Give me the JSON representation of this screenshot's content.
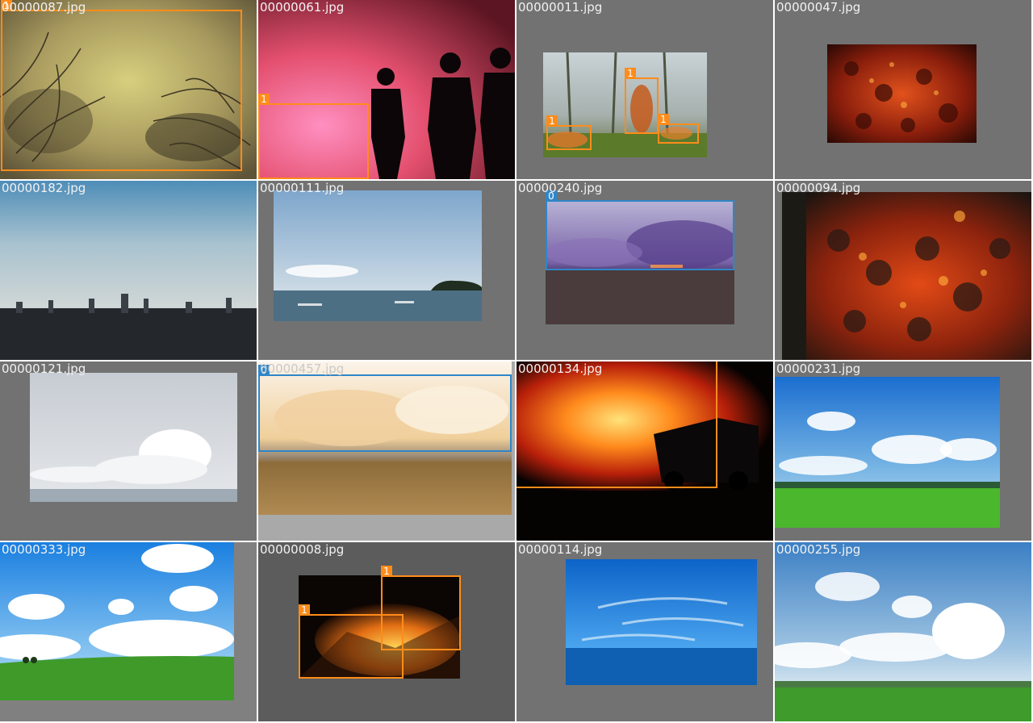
{
  "colors": {
    "gap": "#ffffff",
    "letterbox": "#727272",
    "letterbox_dark": "#5c5c5c",
    "class_1_box": "#ff8c1a",
    "class_0_box": "#2f86c8",
    "filename_text": "#f2f2f2"
  },
  "tiles": [
    {
      "filename": "00000087.jpg",
      "scene": "smoky-brush-fire",
      "boxes": [
        {
          "label": "1"
        }
      ]
    },
    {
      "filename": "00000061.jpg",
      "scene": "firefighters-silhouette-red-smoke",
      "boxes": [
        {
          "label": "1"
        }
      ]
    },
    {
      "filename": "00000011.jpg",
      "scene": "forest-floor-fire",
      "boxes": [
        {
          "label": "1"
        },
        {
          "label": "1"
        },
        {
          "label": "1"
        }
      ]
    },
    {
      "filename": "00000047.jpg",
      "scene": "glowing-embers",
      "boxes": []
    },
    {
      "filename": "00000182.jpg",
      "scene": "city-skyline-haze",
      "boxes": []
    },
    {
      "filename": "00000111.jpg",
      "scene": "sea-with-boats",
      "boxes": []
    },
    {
      "filename": "00000240.jpg",
      "scene": "purple-smoke-over-field",
      "boxes": [
        {
          "label": "0"
        }
      ]
    },
    {
      "filename": "00000094.jpg",
      "scene": "glowing-embers-closeup",
      "boxes": []
    },
    {
      "filename": "00000121.jpg",
      "scene": "cloud-over-sea",
      "boxes": []
    },
    {
      "filename": "00000457.jpg",
      "scene": "smoke-over-dry-grass",
      "boxes": [
        {
          "label": "0"
        }
      ]
    },
    {
      "filename": "00000134.jpg",
      "scene": "fire-truck-blaze",
      "boxes": [
        {
          "label": "1"
        }
      ]
    },
    {
      "filename": "00000231.jpg",
      "scene": "green-meadow-blue-sky",
      "boxes": []
    },
    {
      "filename": "00000333.jpg",
      "scene": "field-with-clouds",
      "boxes": []
    },
    {
      "filename": "00000008.jpg",
      "scene": "night-brush-flames",
      "boxes": [
        {
          "label": "1"
        },
        {
          "label": "1"
        }
      ]
    },
    {
      "filename": "00000114.jpg",
      "scene": "blue-sky-ocean",
      "boxes": []
    },
    {
      "filename": "00000255.jpg",
      "scene": "cumulus-over-countryside",
      "boxes": []
    }
  ]
}
